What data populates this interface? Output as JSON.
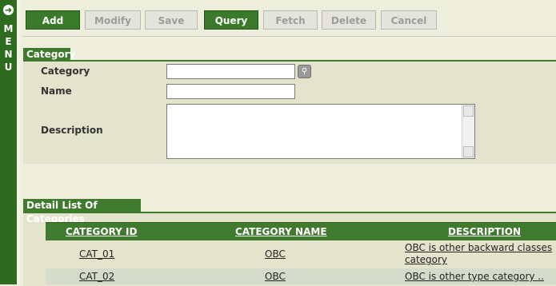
{
  "menu": {
    "letters": [
      "M",
      "E",
      "N",
      "U"
    ],
    "arrow": "➜"
  },
  "toolbar": {
    "add": "Add",
    "modify": "Modify",
    "save": "Save",
    "query": "Query",
    "fetch": "Fetch",
    "delete": "Delete",
    "cancel": "Cancel"
  },
  "form_section": {
    "title": "Category",
    "category_label": "Category",
    "name_label": "Name",
    "description_label": "Description",
    "category_value": "",
    "name_value": "",
    "description_value": ""
  },
  "list_section": {
    "title": "Detail List Of Categories",
    "columns": [
      "CATEGORY ID",
      "CATEGORY NAME",
      "DESCRIPTION"
    ],
    "rows": [
      {
        "id": "CAT_01",
        "name": "OBC",
        "description_line1": "OBC is other backward classes",
        "description_line2": "category"
      },
      {
        "id": "CAT_02",
        "name": "OBC",
        "description_line1": "OBC is other type category ..",
        "description_line2": ""
      }
    ]
  },
  "colors": {
    "accent": "#3f7a2e",
    "menu": "#2f6b1f",
    "panel": "#e4e4cd",
    "row_alt": "#d6dccb"
  }
}
